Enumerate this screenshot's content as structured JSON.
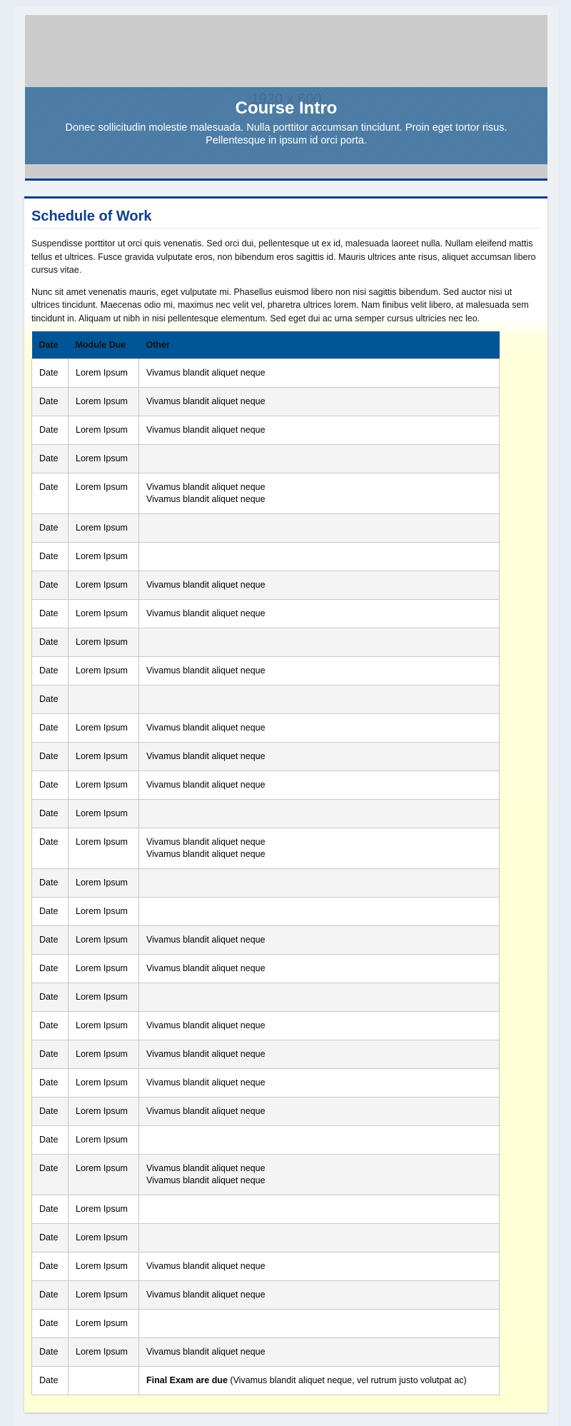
{
  "banner": {
    "placeholder": "1920 x 600",
    "title": "Course Intro",
    "subtitle": "Donec sollicitudin molestie malesuada. Nulla porttitor accumsan tincidunt. Proin eget tortor risus. Pellentesque in ipsum id orci porta."
  },
  "section": {
    "title": "Schedule of Work",
    "paragraphs": [
      "Suspendisse porttitor ut orci quis venenatis. Sed orci dui, pellentesque ut ex id, malesuada laoreet nulla. Nullam eleifend mattis tellus et ultrices. Fusce gravida vulputate eros, non bibendum eros sagittis id. Mauris ultrices ante risus, aliquet accumsan libero cursus vitae.",
      "Nunc sit amet venenatis mauris, eget vulputate mi. Phasellus euismod libero non nisi sagittis bibendum. Sed auctor nisi ut ultrices tincidunt. Maecenas odio mi, maximus nec velit vel, pharetra ultrices lorem. Nam finibus velit libero, at malesuada sem tincidunt in. Aliquam ut nibh in nisi pellentesque elementum. Sed eget dui ac urna semper cursus ultricies nec leo."
    ]
  },
  "table": {
    "headers": [
      "Date",
      "Module Due",
      "Other"
    ],
    "rows": [
      [
        "Date",
        "Lorem Ipsum",
        [
          "Vivamus blandit aliquet neque"
        ]
      ],
      [
        "Date",
        "Lorem Ipsum",
        [
          "Vivamus blandit aliquet neque"
        ]
      ],
      [
        "Date",
        "Lorem Ipsum",
        [
          "Vivamus blandit aliquet neque"
        ]
      ],
      [
        "Date",
        "Lorem Ipsum",
        []
      ],
      [
        "Date",
        "Lorem Ipsum",
        [
          "Vivamus blandit aliquet neque",
          "Vivamus blandit aliquet neque"
        ]
      ],
      [
        "Date",
        "Lorem Ipsum",
        []
      ],
      [
        "Date",
        "Lorem Ipsum",
        []
      ],
      [
        "Date",
        "Lorem Ipsum",
        [
          "Vivamus blandit aliquet neque"
        ]
      ],
      [
        "Date",
        "Lorem Ipsum",
        [
          "Vivamus blandit aliquet neque"
        ]
      ],
      [
        "Date",
        "Lorem Ipsum",
        []
      ],
      [
        "Date",
        "Lorem Ipsum",
        [
          "Vivamus blandit aliquet neque"
        ]
      ],
      [
        "Date",
        "",
        []
      ],
      [
        "Date",
        "Lorem Ipsum",
        [
          "Vivamus blandit aliquet neque"
        ]
      ],
      [
        "Date",
        "Lorem Ipsum",
        [
          "Vivamus blandit aliquet neque"
        ]
      ],
      [
        "Date",
        "Lorem Ipsum",
        [
          "Vivamus blandit aliquet neque"
        ]
      ],
      [
        "Date",
        "Lorem Ipsum",
        []
      ],
      [
        "Date",
        "Lorem Ipsum",
        [
          "Vivamus blandit aliquet neque",
          "Vivamus blandit aliquet neque"
        ]
      ],
      [
        "Date",
        "Lorem Ipsum",
        []
      ],
      [
        "Date",
        "Lorem Ipsum",
        []
      ],
      [
        "Date",
        "Lorem Ipsum",
        [
          "Vivamus blandit aliquet neque"
        ]
      ],
      [
        "Date",
        "Lorem Ipsum",
        [
          "Vivamus blandit aliquet neque"
        ]
      ],
      [
        "Date",
        "Lorem Ipsum",
        []
      ],
      [
        "Date",
        "Lorem Ipsum",
        [
          "Vivamus blandit aliquet neque"
        ]
      ],
      [
        "Date",
        "Lorem Ipsum",
        [
          "Vivamus blandit aliquet neque"
        ]
      ],
      [
        "Date",
        "Lorem Ipsum",
        [
          "Vivamus blandit aliquet neque"
        ]
      ],
      [
        "Date",
        "Lorem Ipsum",
        [
          "Vivamus blandit aliquet neque"
        ]
      ],
      [
        "Date",
        "Lorem Ipsum",
        []
      ],
      [
        "Date",
        "Lorem Ipsum",
        [
          "Vivamus blandit aliquet neque",
          "Vivamus blandit aliquet neque"
        ]
      ],
      [
        "Date",
        "Lorem Ipsum",
        []
      ],
      [
        "Date",
        "Lorem Ipsum",
        []
      ],
      [
        "Date",
        "Lorem Ipsum",
        [
          "Vivamus blandit aliquet neque"
        ]
      ],
      [
        "Date",
        "Lorem Ipsum",
        [
          "Vivamus blandit aliquet neque"
        ]
      ],
      [
        "Date",
        "Lorem Ipsum",
        []
      ],
      [
        "Date",
        "Lorem Ipsum",
        [
          "Vivamus blandit aliquet neque"
        ]
      ]
    ],
    "final_row": {
      "date": "Date",
      "module": "",
      "bold": "Final Exam are due",
      "rest": " (Vivamus blandit aliquet neque, vel rutrum justo volutpat ac)"
    }
  },
  "colors": {
    "accent": "#0a3d8a",
    "header": "#005596",
    "band": "#4a7aa3"
  }
}
